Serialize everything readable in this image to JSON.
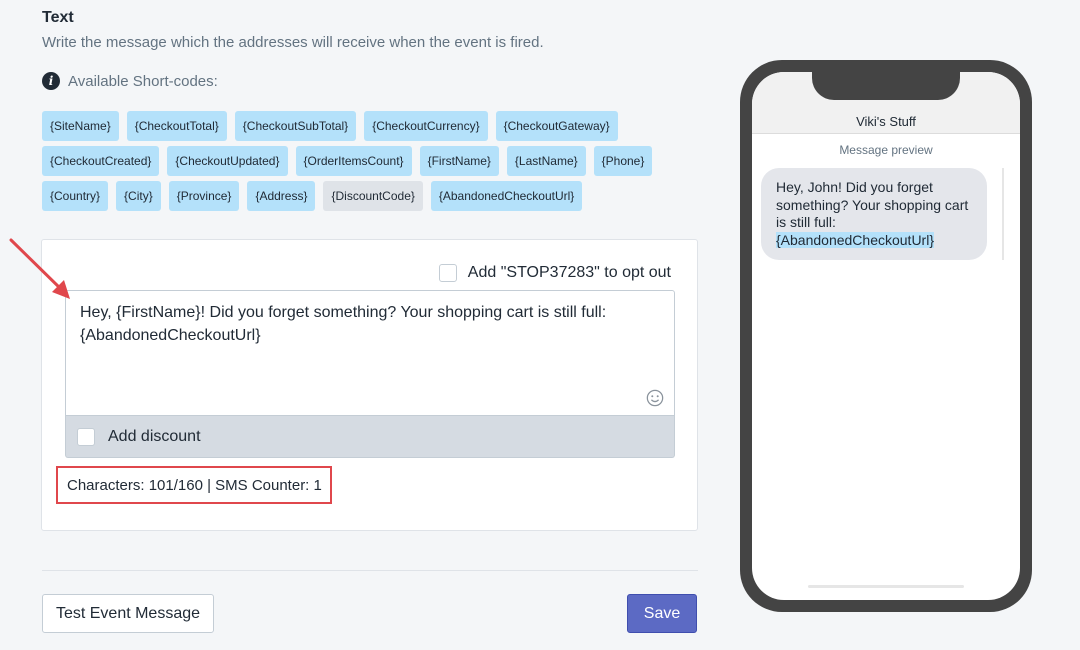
{
  "section": {
    "title": "Text",
    "description": "Write the message which the addresses will receive when the event is fired.",
    "shortcodes_heading": "Available Short-codes:"
  },
  "shortcodes": {
    "row1": [
      "{SiteName}",
      "{CheckoutTotal}",
      "{CheckoutSubTotal}",
      "{CheckoutCurrency}",
      "{CheckoutGateway}"
    ],
    "row2": [
      "{CheckoutCreated}",
      "{CheckoutUpdated}",
      "{OrderItemsCount}",
      "{FirstName}",
      "{LastName}",
      "{Phone}"
    ],
    "row3": [
      "{Country}",
      "{City}",
      "{Province}",
      "{Address}",
      "{DiscountCode}",
      "{AbandonedCheckoutUrl}"
    ],
    "disabled": "{DiscountCode}"
  },
  "editor": {
    "optout_label": "Add \"STOP37283\" to opt out",
    "optout_checked": false,
    "message_line1": "Hey, {FirstName}! Did you forget something? Your shopping cart is still full:",
    "message_line2": "{AbandonedCheckoutUrl}",
    "discount_label": "Add discount",
    "discount_checked": false,
    "counter": "Characters: 101/160 | SMS Counter: 1"
  },
  "buttons": {
    "test": "Test Event Message",
    "save": "Save"
  },
  "preview": {
    "contact_name": "Viki's Stuff",
    "label": "Message preview",
    "bubble_text": "Hey, John! Did you forget something? Your shopping cart is still full:",
    "bubble_link": "{AbandonedCheckoutUrl}"
  },
  "colors": {
    "tag_bg": "#b4e1fa",
    "tag_disabled_bg": "#dfe3e8",
    "save_button": "#5c6ac4",
    "highlight_box": "#e0474c",
    "phone_frame": "#444444"
  },
  "icons": {
    "info": "info-icon",
    "emoji": "smiley-icon",
    "annotation": "red-arrow-icon"
  }
}
